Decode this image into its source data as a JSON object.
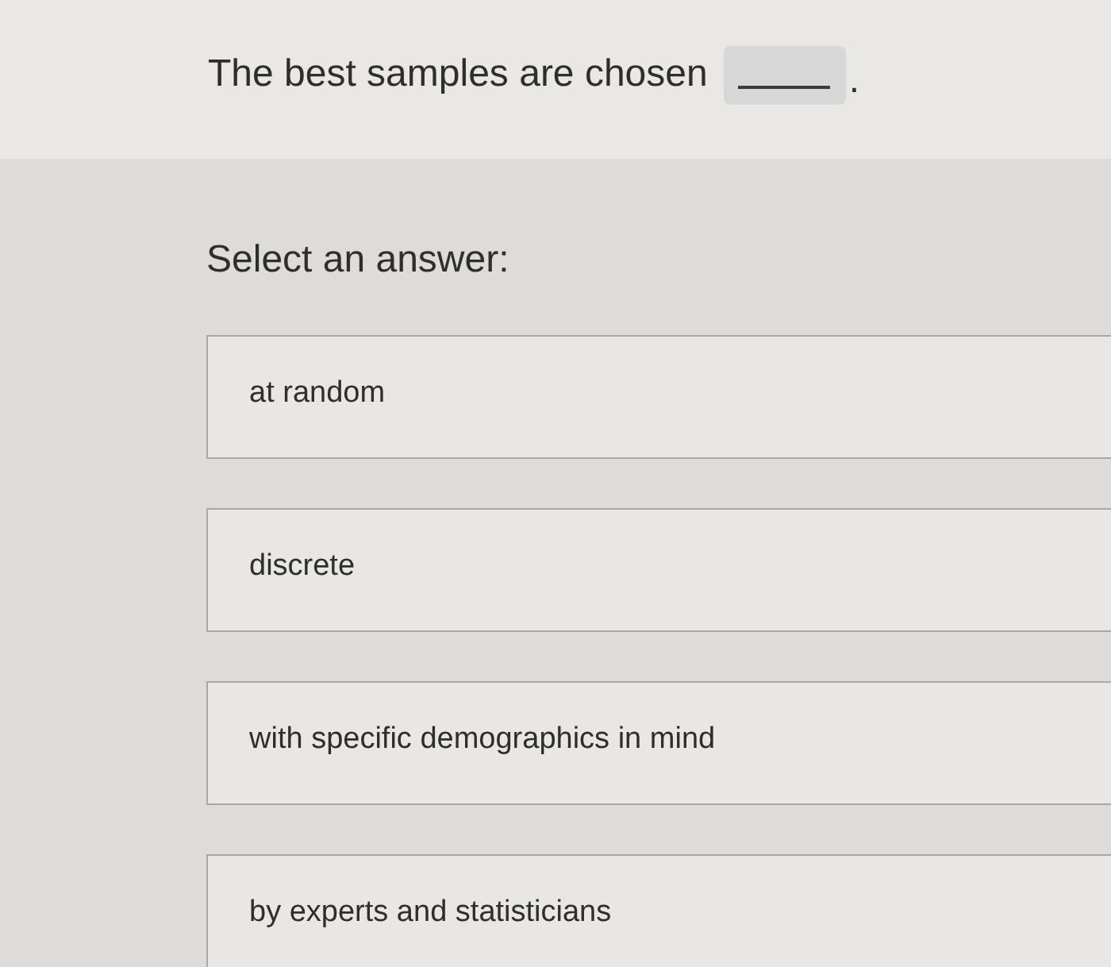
{
  "question": {
    "text": "The best samples are chosen",
    "blank": {
      "filled": false
    },
    "after": "."
  },
  "prompt": "Select an answer:",
  "options": [
    {
      "label": "at random",
      "selected": false
    },
    {
      "label": "discrete",
      "selected": false
    },
    {
      "label": "with specific demographics in mind",
      "selected": false
    },
    {
      "label": "by experts and statisticians",
      "selected": false
    }
  ]
}
